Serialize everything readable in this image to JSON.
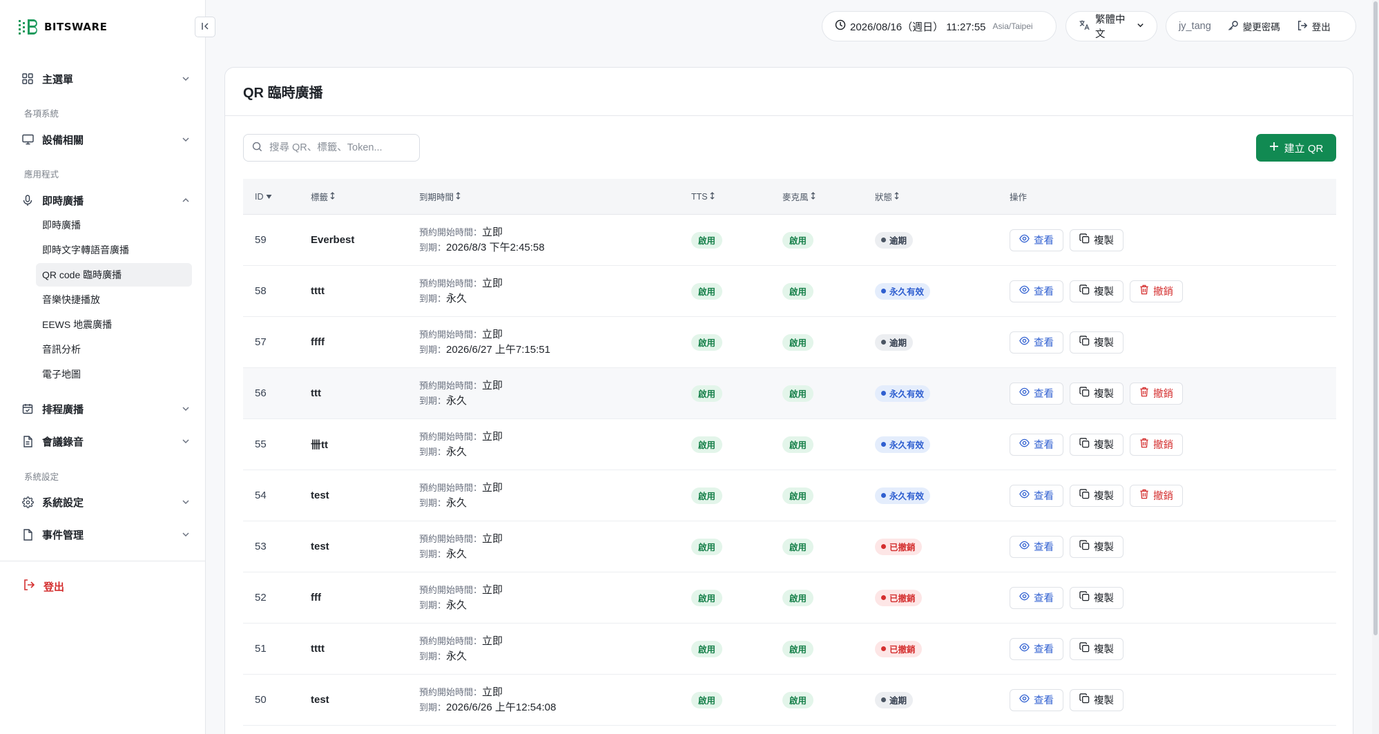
{
  "brand": {
    "name": "BITSWARE"
  },
  "header": {
    "datetime": "2026/08/16（週日） 11:27:55",
    "timezone": "Asia/Taipei",
    "language": "繁體中文",
    "username": "jy_tang",
    "change_password": "變更密碼",
    "logout": "登出"
  },
  "sidebar": {
    "main_menu": "主選單",
    "section_systems": "各項系統",
    "devices": "設備相關",
    "section_apps": "應用程式",
    "live_broadcast": "即時廣播",
    "sub_items": [
      {
        "label": "即時廣播"
      },
      {
        "label": "即時文字轉語音廣播"
      },
      {
        "label": "QR code 臨時廣播"
      },
      {
        "label": "音樂快捷播放"
      },
      {
        "label": "EEWS 地震廣播"
      },
      {
        "label": "音訊分析"
      },
      {
        "label": "電子地圖"
      }
    ],
    "schedule": "排程廣播",
    "meeting": "會議錄音",
    "section_settings": "系統設定",
    "system_settings": "系統設定",
    "events": "事件管理",
    "logout": "登出"
  },
  "page": {
    "title": "QR 臨時廣播",
    "search_placeholder": "搜尋 QR、標籤、Token...",
    "create_label": "建立 QR"
  },
  "table": {
    "headers": {
      "id": "ID",
      "tag": "標籤",
      "expiry": "到期時間",
      "tts": "TTS",
      "mic": "麥克風",
      "status": "狀態",
      "actions": "操作"
    },
    "start_prefix": "預約開始時間：",
    "expire_prefix": "到期：",
    "view_label": "查看",
    "copy_label": "複製",
    "revoke_label": "撤銷",
    "rows": [
      {
        "id": "59",
        "tag": "Everbest",
        "start": "立即",
        "expire": "2026/8/3 下午2:45:58",
        "tts": "啟用",
        "mic": "啟用",
        "status": "逾期",
        "status_kind": "expired",
        "revocable": false
      },
      {
        "id": "58",
        "tag": "tttt",
        "start": "立即",
        "expire": "永久",
        "tts": "啟用",
        "mic": "啟用",
        "status": "永久有效",
        "status_kind": "perm",
        "revocable": true
      },
      {
        "id": "57",
        "tag": "ffff",
        "start": "立即",
        "expire": "2026/6/27 上午7:15:51",
        "tts": "啟用",
        "mic": "啟用",
        "status": "逾期",
        "status_kind": "expired",
        "revocable": false
      },
      {
        "id": "56",
        "tag": "ttt",
        "start": "立即",
        "expire": "永久",
        "tts": "啟用",
        "mic": "啟用",
        "status": "永久有效",
        "status_kind": "perm",
        "revocable": true
      },
      {
        "id": "55",
        "tag": "卌tt",
        "start": "立即",
        "expire": "永久",
        "tts": "啟用",
        "mic": "啟用",
        "status": "永久有效",
        "status_kind": "perm",
        "revocable": true
      },
      {
        "id": "54",
        "tag": "test",
        "start": "立即",
        "expire": "永久",
        "tts": "啟用",
        "mic": "啟用",
        "status": "永久有效",
        "status_kind": "perm",
        "revocable": true
      },
      {
        "id": "53",
        "tag": "test",
        "start": "立即",
        "expire": "永久",
        "tts": "啟用",
        "mic": "啟用",
        "status": "已撤銷",
        "status_kind": "revoked",
        "revocable": false
      },
      {
        "id": "52",
        "tag": "fff",
        "start": "立即",
        "expire": "永久",
        "tts": "啟用",
        "mic": "啟用",
        "status": "已撤銷",
        "status_kind": "revoked",
        "revocable": false
      },
      {
        "id": "51",
        "tag": "tttt",
        "start": "立即",
        "expire": "永久",
        "tts": "啟用",
        "mic": "啟用",
        "status": "已撤銷",
        "status_kind": "revoked",
        "revocable": false
      },
      {
        "id": "50",
        "tag": "test",
        "start": "立即",
        "expire": "2026/6/26 上午12:54:08",
        "tts": "啟用",
        "mic": "啟用",
        "status": "逾期",
        "status_kind": "expired",
        "revocable": false
      }
    ]
  },
  "colors": {
    "brand_green": "#118a52",
    "status_expired": "#4b5563",
    "status_permanent": "#2f5fd0",
    "status_revoked": "#d42f2f"
  }
}
